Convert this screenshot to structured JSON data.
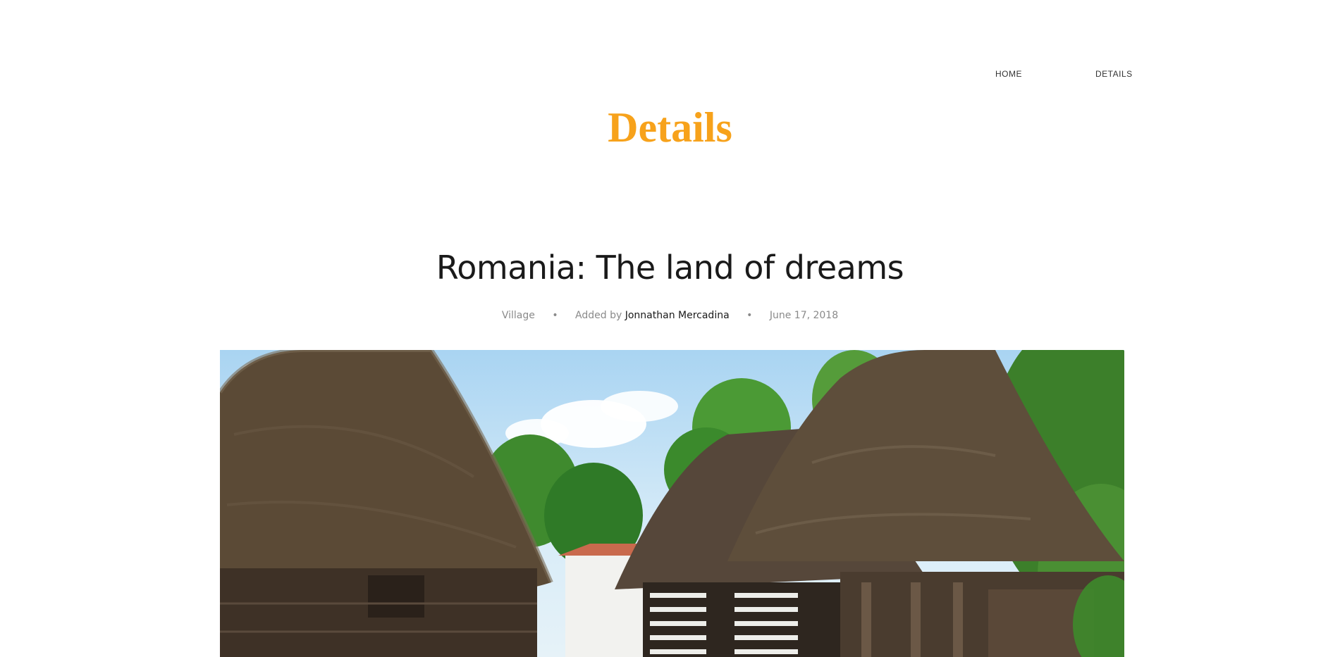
{
  "nav": {
    "items": [
      {
        "label": "HOME"
      },
      {
        "label": "DETAILS"
      }
    ]
  },
  "page": {
    "title": "Details"
  },
  "post": {
    "title": "Romania: The land of dreams",
    "category": "Village",
    "added_by_prefix": "Added by",
    "author": "Jonnathan Mercadina",
    "date": "June 17, 2018",
    "separator": "•"
  },
  "colors": {
    "accent": "#f7a21b",
    "text_dark": "#1a1a1a",
    "text_muted": "#8a8a8a"
  },
  "hero": {
    "image_icon": "photo-thatched-houses"
  }
}
